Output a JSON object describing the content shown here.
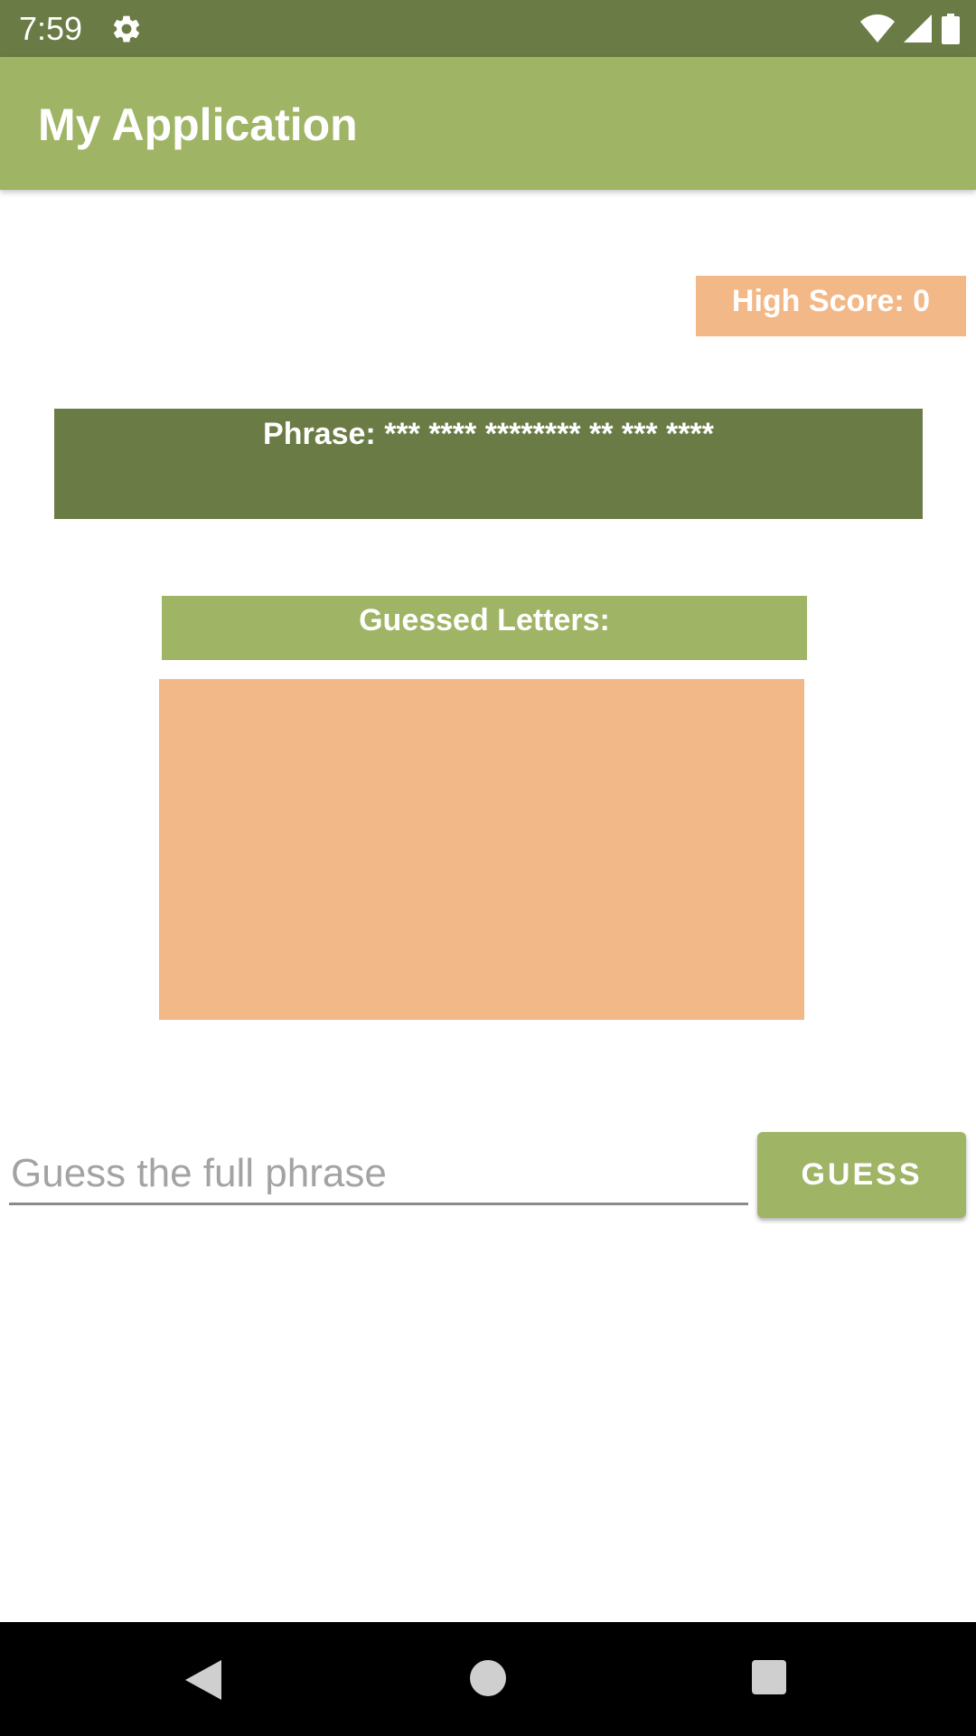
{
  "status_bar": {
    "time": "7:59",
    "icons": [
      "gear-icon",
      "wifi-icon",
      "signal-icon",
      "battery-icon"
    ],
    "background": "#6b7b45"
  },
  "app_bar": {
    "title": "My Application",
    "background": "#9fb465"
  },
  "score": {
    "high_score_text": "High Score: 0"
  },
  "phrase": {
    "text": "Phrase: *** **** ******** ** *** ****"
  },
  "guessed": {
    "header": "Guessed Letters:",
    "letters": ""
  },
  "guess_form": {
    "input_value": "",
    "input_placeholder": "Guess the full phrase",
    "button_label": "GUESS"
  },
  "nav_bar": {
    "icons": [
      "back-icon",
      "home-icon",
      "recents-icon"
    ]
  },
  "colors": {
    "olive_dark": "#6b7b45",
    "olive_light": "#9fb465",
    "peach": "#f3b887"
  }
}
